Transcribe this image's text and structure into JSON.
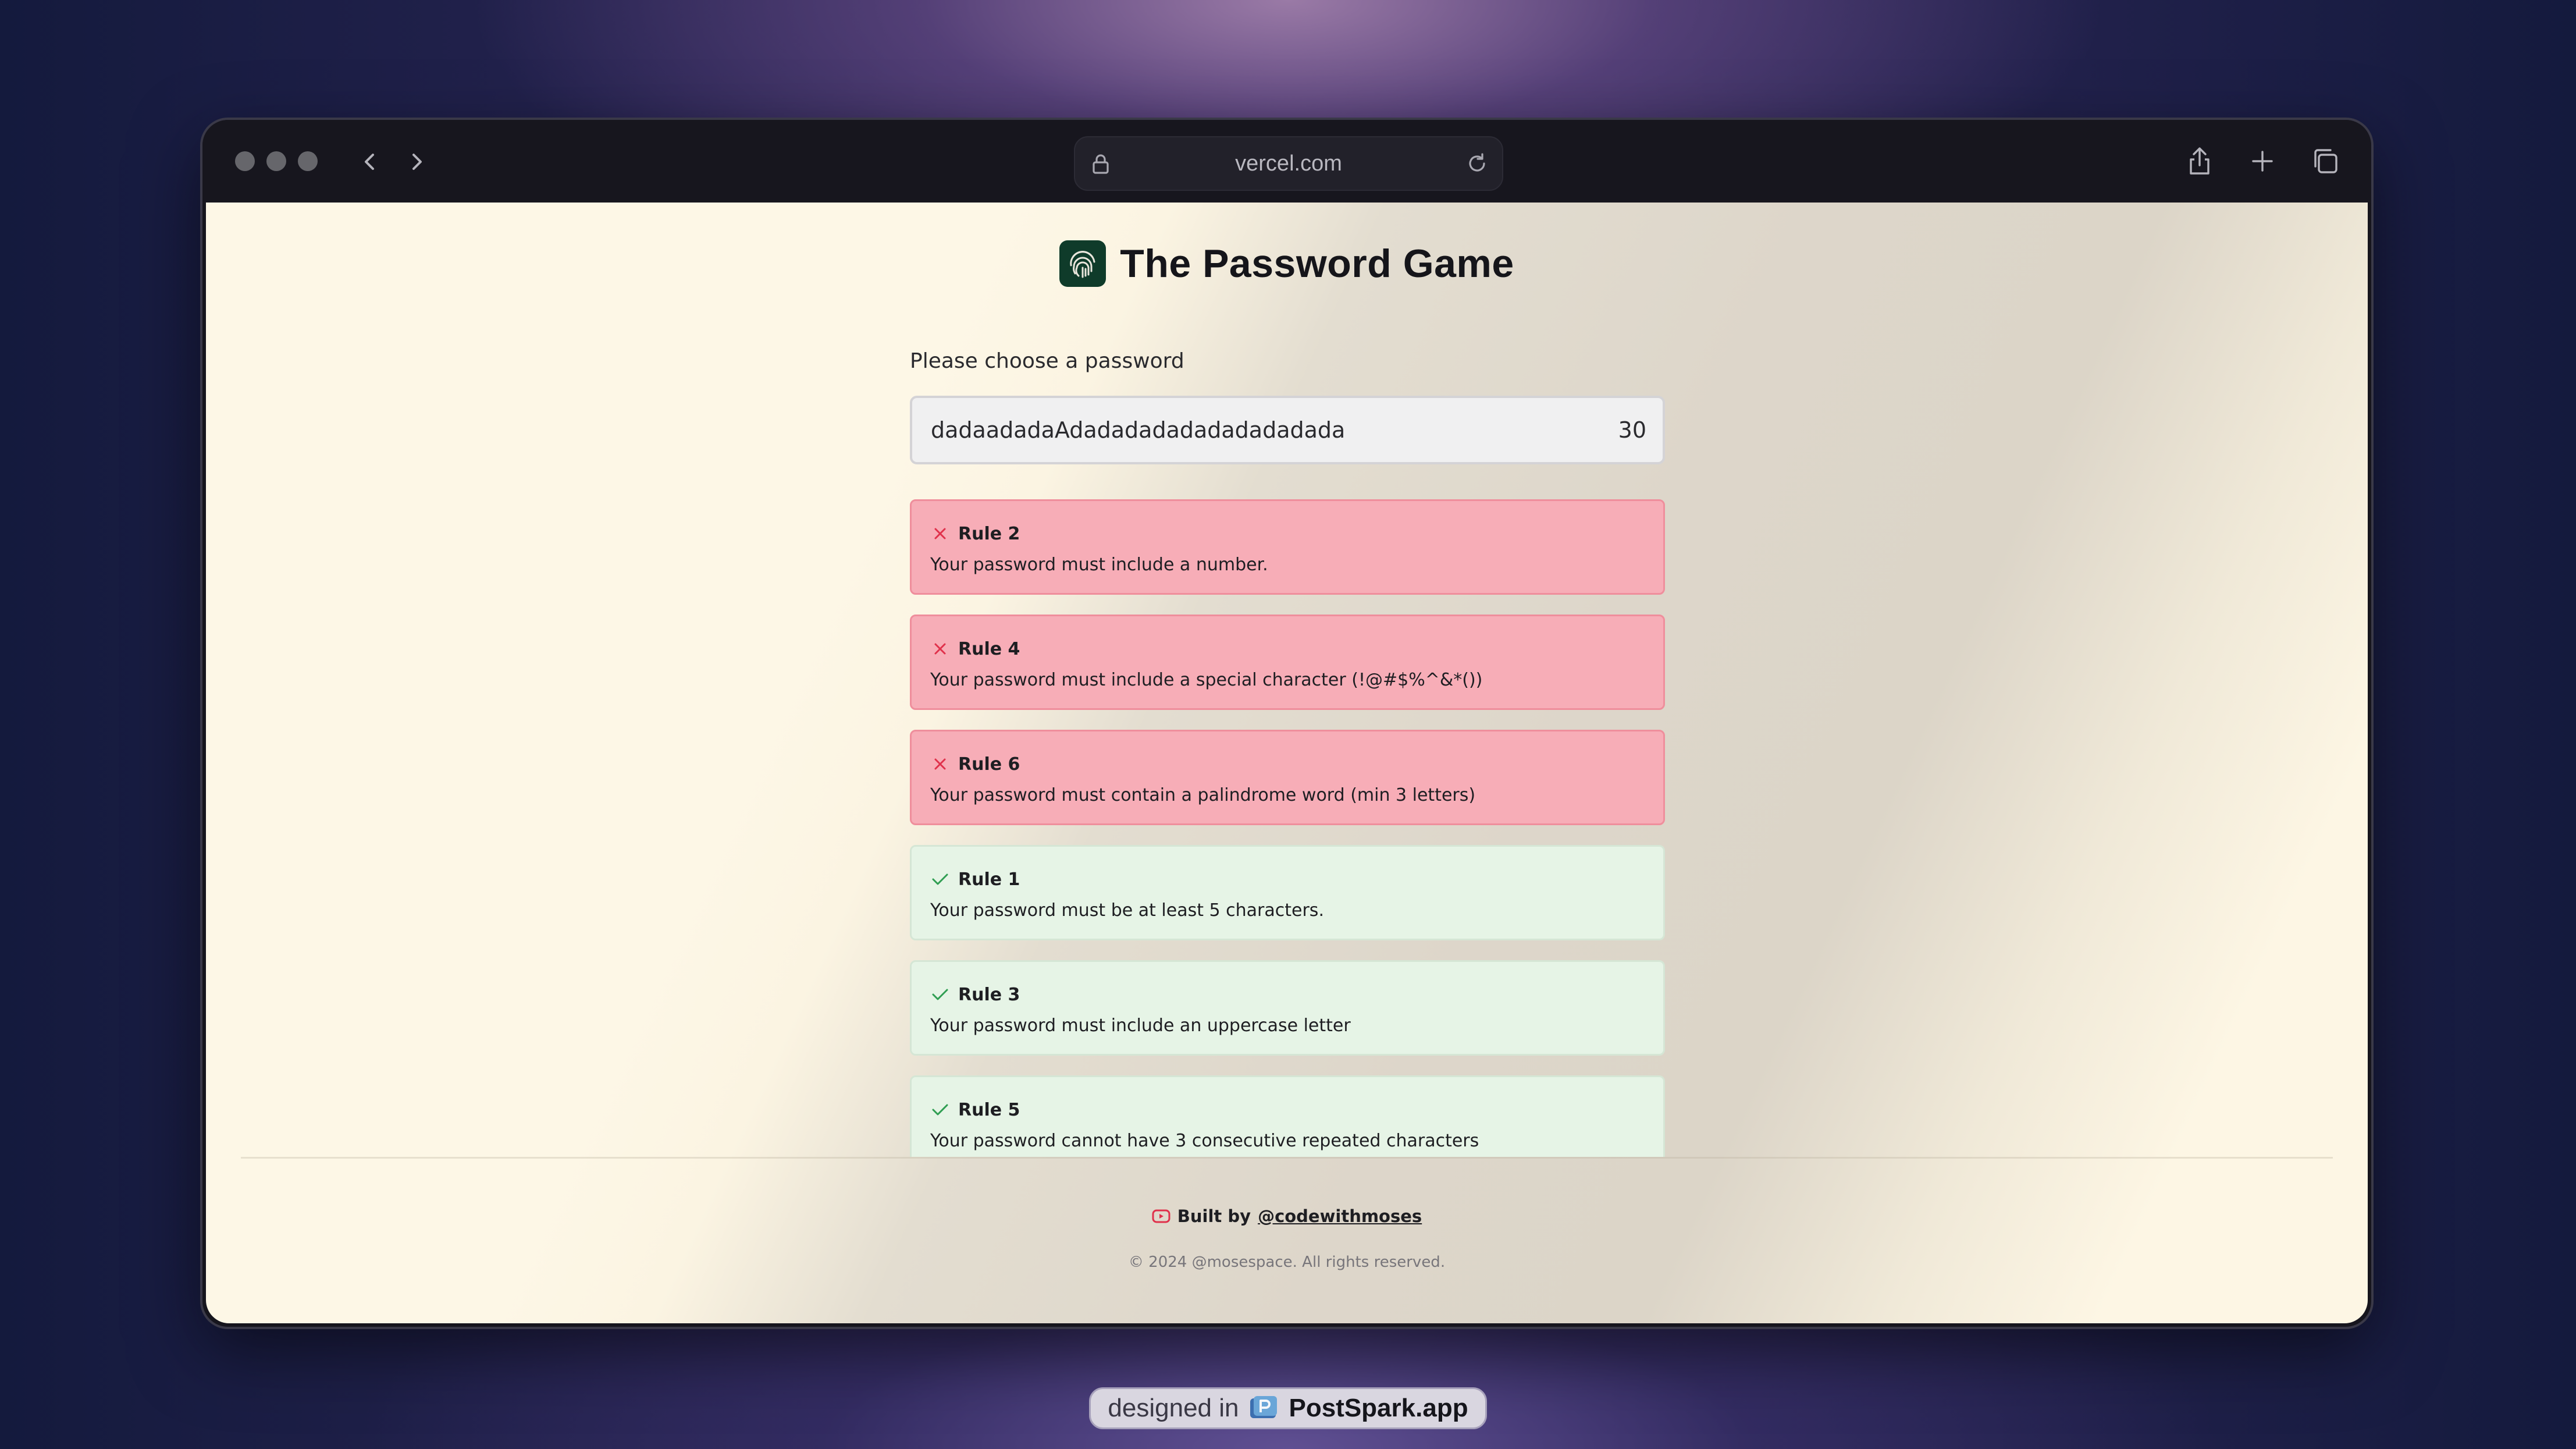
{
  "browser": {
    "url": "vercel.com",
    "traffic_lights": [
      "close",
      "minimize",
      "zoom"
    ],
    "icons": {
      "back": "chevron-left-icon",
      "forward": "chevron-right-icon",
      "lock": "lock-icon",
      "reload": "reload-icon",
      "share": "share-icon",
      "new_tab": "plus-icon",
      "tabs": "tabs-icon"
    }
  },
  "page": {
    "title": "The Password Game",
    "logo_icon": "fingerprint-icon",
    "prompt": "Please choose a password",
    "password": {
      "value": "dadaadadaAdadadadadadadadadada",
      "length": "30"
    },
    "rules": [
      {
        "name": "Rule 2",
        "description": "Your password must include a number.",
        "status": "fail"
      },
      {
        "name": "Rule 4",
        "description": "Your password must include a special character (!@#$%^&*())",
        "status": "fail"
      },
      {
        "name": "Rule 6",
        "description": "Your password must contain a palindrome word (min 3 letters)",
        "status": "fail"
      },
      {
        "name": "Rule 1",
        "description": "Your password must be at least 5 characters.",
        "status": "pass"
      },
      {
        "name": "Rule 3",
        "description": "Your password must include an uppercase letter",
        "status": "pass"
      },
      {
        "name": "Rule 5",
        "description": "Your password cannot have 3 consecutive repeated characters",
        "status": "pass"
      }
    ],
    "footer": {
      "built_by_prefix": "Built by",
      "built_by_handle": "@codewithmoses",
      "copyright": "© 2024 @mosespace. All rights reserved."
    }
  },
  "badge": {
    "prefix": "designed in",
    "brand": "PostSpark.app"
  },
  "colors": {
    "fail_bg": "#f7adb7",
    "pass_bg": "#e6f4e6",
    "fail_icon": "#e0314b",
    "pass_icon": "#2f9e52",
    "logo_bg": "#0f3b2a"
  }
}
